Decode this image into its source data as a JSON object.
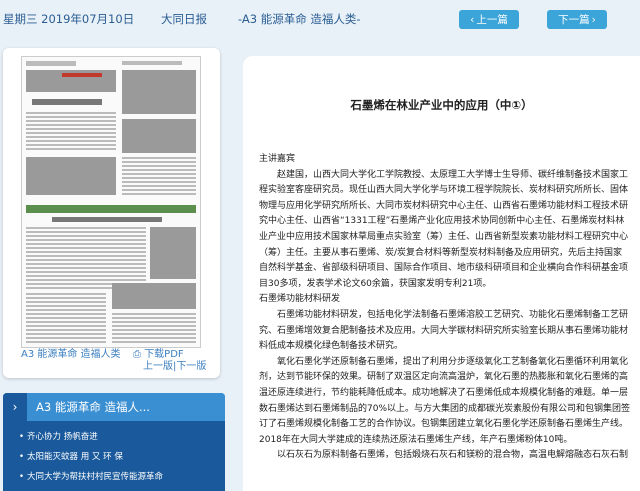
{
  "header": {
    "weekday_date": "星期三 2019年07月10日",
    "newspaper": "大同日报",
    "section": "-A3 能源革命 造福人类-",
    "prev_label": "上一篇",
    "next_label": "下一篇"
  },
  "page_card": {
    "section_label": "A3 能源革命 造福人类",
    "download_pdf": "下载PDF",
    "prev_page": "上一版",
    "separator": "|",
    "next_page": "下一版",
    "thumb_texts": {
      "headline": "齐心协力　扬帆奋进",
      "mid_caption": "石墨烯在林业产业中的应用"
    }
  },
  "nav": {
    "section_title": "A3 能源革命 造福人...",
    "items": [
      "齐心协力 扬帆奋进",
      "太阳能灭蚊器 用 又 环 保",
      "大同大学为帮扶村村民宣传能源革命"
    ]
  },
  "article": {
    "title": "石墨烯在林业产业中的应用（中①）",
    "paragraphs": [
      {
        "indent": false,
        "text": "主讲嘉宾"
      },
      {
        "indent": true,
        "text": "赵建国，山西大同大学化工学院教授、太原理工大学博士生导师、碳纤维制备技术国家工程实验室客座研究员。现任山西大同大学化学与环境工程学院院长、炭材料研究所所长、固体物理与应用化学研究所所长、大同市炭材料研究中心主任、山西省石墨烯功能材料工程技术研究中心主任、山西省“1331工程”石墨烯产业化应用技术协同创新中心主任、石墨烯炭材料林业产业中应用技术国家林草局重点实验室（筹）主任、山西省新型炭素功能材料工程研究中心（筹）主任。主要从事石墨烯、炭/炭复合材料等新型炭材料制备及应用研究，先后主持国家自然科学基金、省部级科研项目、国际合作项目、地市级科研项目和企业横向合作科研基金项目30多项，发表学术论文60余篇，获国家发明专利21项。"
      },
      {
        "indent": false,
        "text": "石墨烯功能材料研发"
      },
      {
        "indent": true,
        "text": "石墨烯功能材料研发，包括电化学法制备石墨烯溶胶工艺研究、功能化石墨烯制备工艺研究、石墨烯增效复合肥制备技术及应用。大同大学碳材料研究所实验室长期从事石墨烯功能材料低成本规模化绿色制备技术研究。"
      },
      {
        "indent": true,
        "text": "氧化石墨化学还原制备石墨烯，提出了利用分步逐级氧化工艺制备氧化石墨循环利用氧化剂，达到节能环保的效果。研制了双温区定向流高温炉，氧化石墨的热膨胀和氧化石墨烯的高温还原连续进行，节约能耗降低成本。成功地解决了石墨烯低成本规模化制备的难题。单一层数石墨烯达到石墨烯制品的70%以上。与方大集团的成都碳光炭素股份有限公司和包钢集团签订了石墨烯规模化制备工艺的合作协议。包钢集团建立氧化石墨化学还原制备石墨烯生产线。2018年在大同大学建成的连续热还原法石墨烯生产线，年产石墨烯粉体10吨。"
      },
      {
        "indent": true,
        "text": "以石灰石为原料制备石墨烯，包括煅烧石灰石和镁粉的混合物，高温电解熔融态石灰石制"
      }
    ]
  }
}
